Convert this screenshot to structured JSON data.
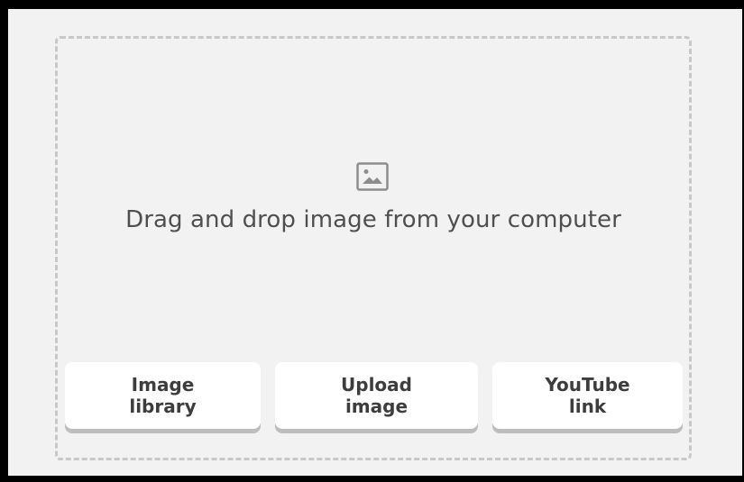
{
  "dropzone": {
    "icon": "image-icon",
    "text": "Drag and drop image from your computer"
  },
  "buttons": {
    "image_library": "Image library",
    "upload_image": "Upload image",
    "youtube_link": "YouTube link"
  },
  "colors": {
    "panel_background": "#f2f2f2",
    "dashed_border": "#c8c8c8",
    "button_background": "#ffffff",
    "button_shadow": "#bdbdbd",
    "text": "#4f4f4f"
  }
}
